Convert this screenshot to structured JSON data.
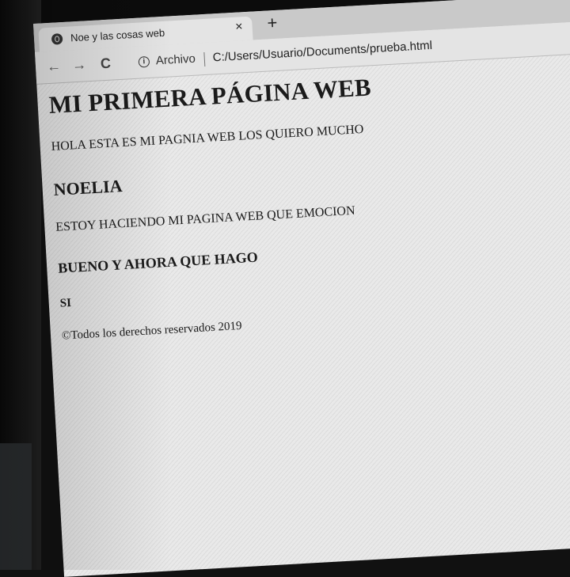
{
  "browser": {
    "tab_title": "Noe y las cosas web",
    "tab_close": "×",
    "new_tab": "+",
    "nav_back": "←",
    "nav_forward": "→",
    "nav_reload": "C",
    "info_label": "i",
    "archivo_label": "Archivo",
    "url": "C:/Users/Usuario/Documents/prueba.html"
  },
  "page": {
    "heading": "MI PRIMERA PÁGINA WEB",
    "intro": "HOLA ESTA ES MI PAGNIA WEB LOS QUIERO MUCHO",
    "name": "NOELIA",
    "status": "ESTOY HACIENDO MI PAGINA WEB QUE EMOCION",
    "question": "BUENO Y AHORA QUE HAGO",
    "answer": "SI",
    "footer": "©Todos los derechos reservados 2019"
  }
}
